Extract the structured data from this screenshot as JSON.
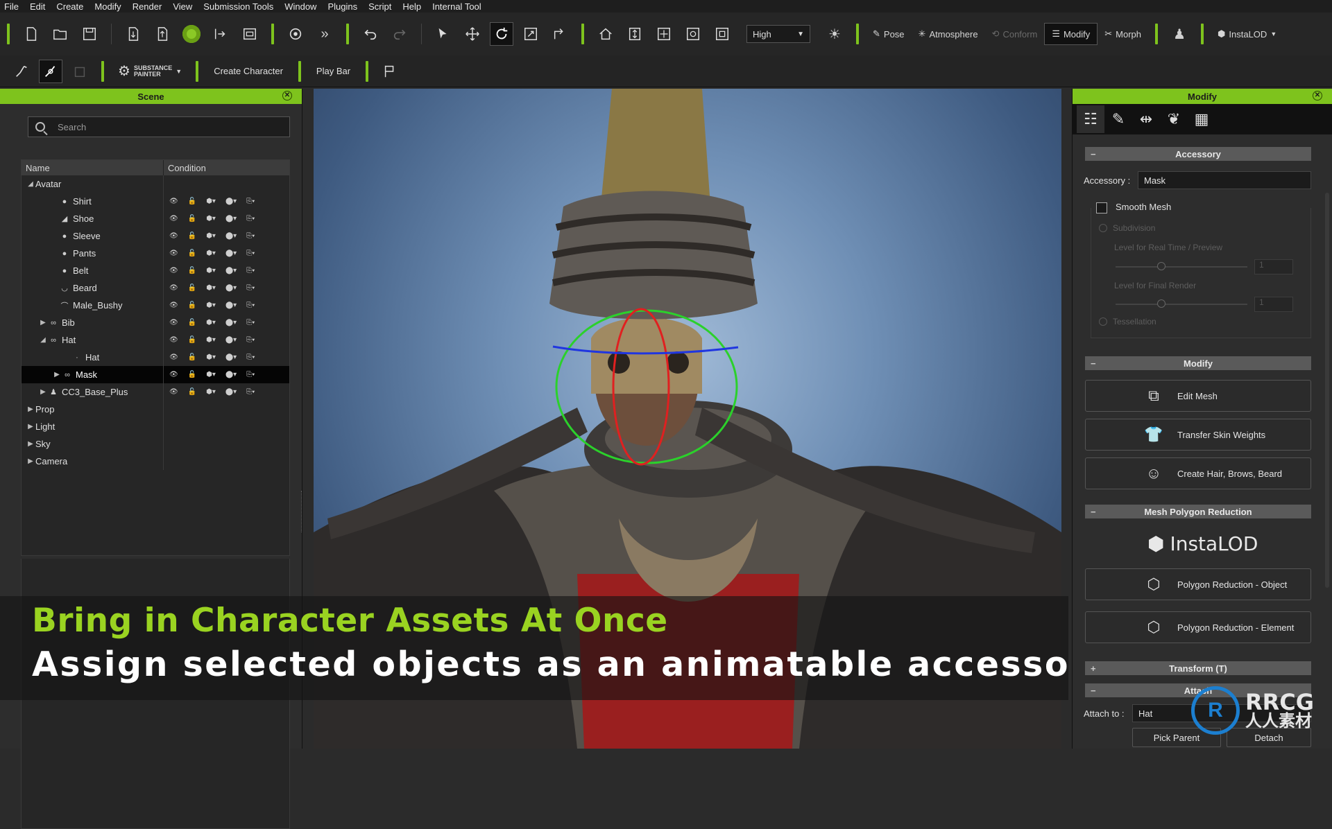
{
  "menu": [
    "File",
    "Edit",
    "Create",
    "Modify",
    "Render",
    "View",
    "Submission Tools",
    "Window",
    "Plugins",
    "Script",
    "Help",
    "Internal Tool"
  ],
  "toolbar": {
    "quality": "High",
    "pose": "Pose",
    "atmosphere": "Atmosphere",
    "conform": "Conform",
    "modify": "Modify",
    "morph": "Morph",
    "instalod": "InstaLOD"
  },
  "toolbar2": {
    "substance_line1": "SUBSTANCE",
    "substance_line2": "PAINTER",
    "create_character": "Create Character",
    "play_bar": "Play Bar"
  },
  "scene": {
    "title": "Scene",
    "search_placeholder": "Search",
    "col_name": "Name",
    "col_condition": "Condition",
    "rows": [
      {
        "label": "Avatar"
      },
      {
        "label": "Shirt"
      },
      {
        "label": "Shoe"
      },
      {
        "label": "Sleeve"
      },
      {
        "label": "Pants"
      },
      {
        "label": "Belt"
      },
      {
        "label": "Beard"
      },
      {
        "label": "Male_Bushy"
      },
      {
        "label": "Bib"
      },
      {
        "label": "Hat"
      },
      {
        "label": "Hat"
      },
      {
        "label": "Mask"
      },
      {
        "label": "CC3_Base_Plus"
      },
      {
        "label": "Prop"
      },
      {
        "label": "Light"
      },
      {
        "label": "Sky"
      },
      {
        "label": "Camera"
      }
    ]
  },
  "modify": {
    "title": "Modify",
    "accessory_section": "Accessory",
    "accessory_label": "Accessory :",
    "accessory_value": "Mask",
    "smooth_mesh": "Smooth Mesh",
    "subdivision": "Subdivision",
    "level_realtime": "Level for Real Time / Preview",
    "level_final": "Level for Final Render",
    "level_value_1": "1",
    "level_value_2": "1",
    "tessellation": "Tessellation",
    "modify_section": "Modify",
    "edit_mesh": "Edit Mesh",
    "transfer_skin": "Transfer Skin Weights",
    "create_hair": "Create Hair, Brows, Beard",
    "poly_section": "Mesh Polygon Reduction",
    "instalod_logo": "InstaLOD",
    "poly_object": "Polygon Reduction - Object",
    "poly_element": "Polygon Reduction - Element",
    "transform_section": "Transform  (T)",
    "attach_section": "Attach",
    "attach_to_label": "Attach to :",
    "attach_to_value": "Hat",
    "pick_parent": "Pick Parent",
    "detach": "Detach"
  },
  "caption": {
    "line1": "Bring in Character Assets At Once",
    "line2": "Assign selected objects as an animatable accessory"
  },
  "watermark": {
    "brand": "RRCG",
    "sub": "人人素材"
  }
}
